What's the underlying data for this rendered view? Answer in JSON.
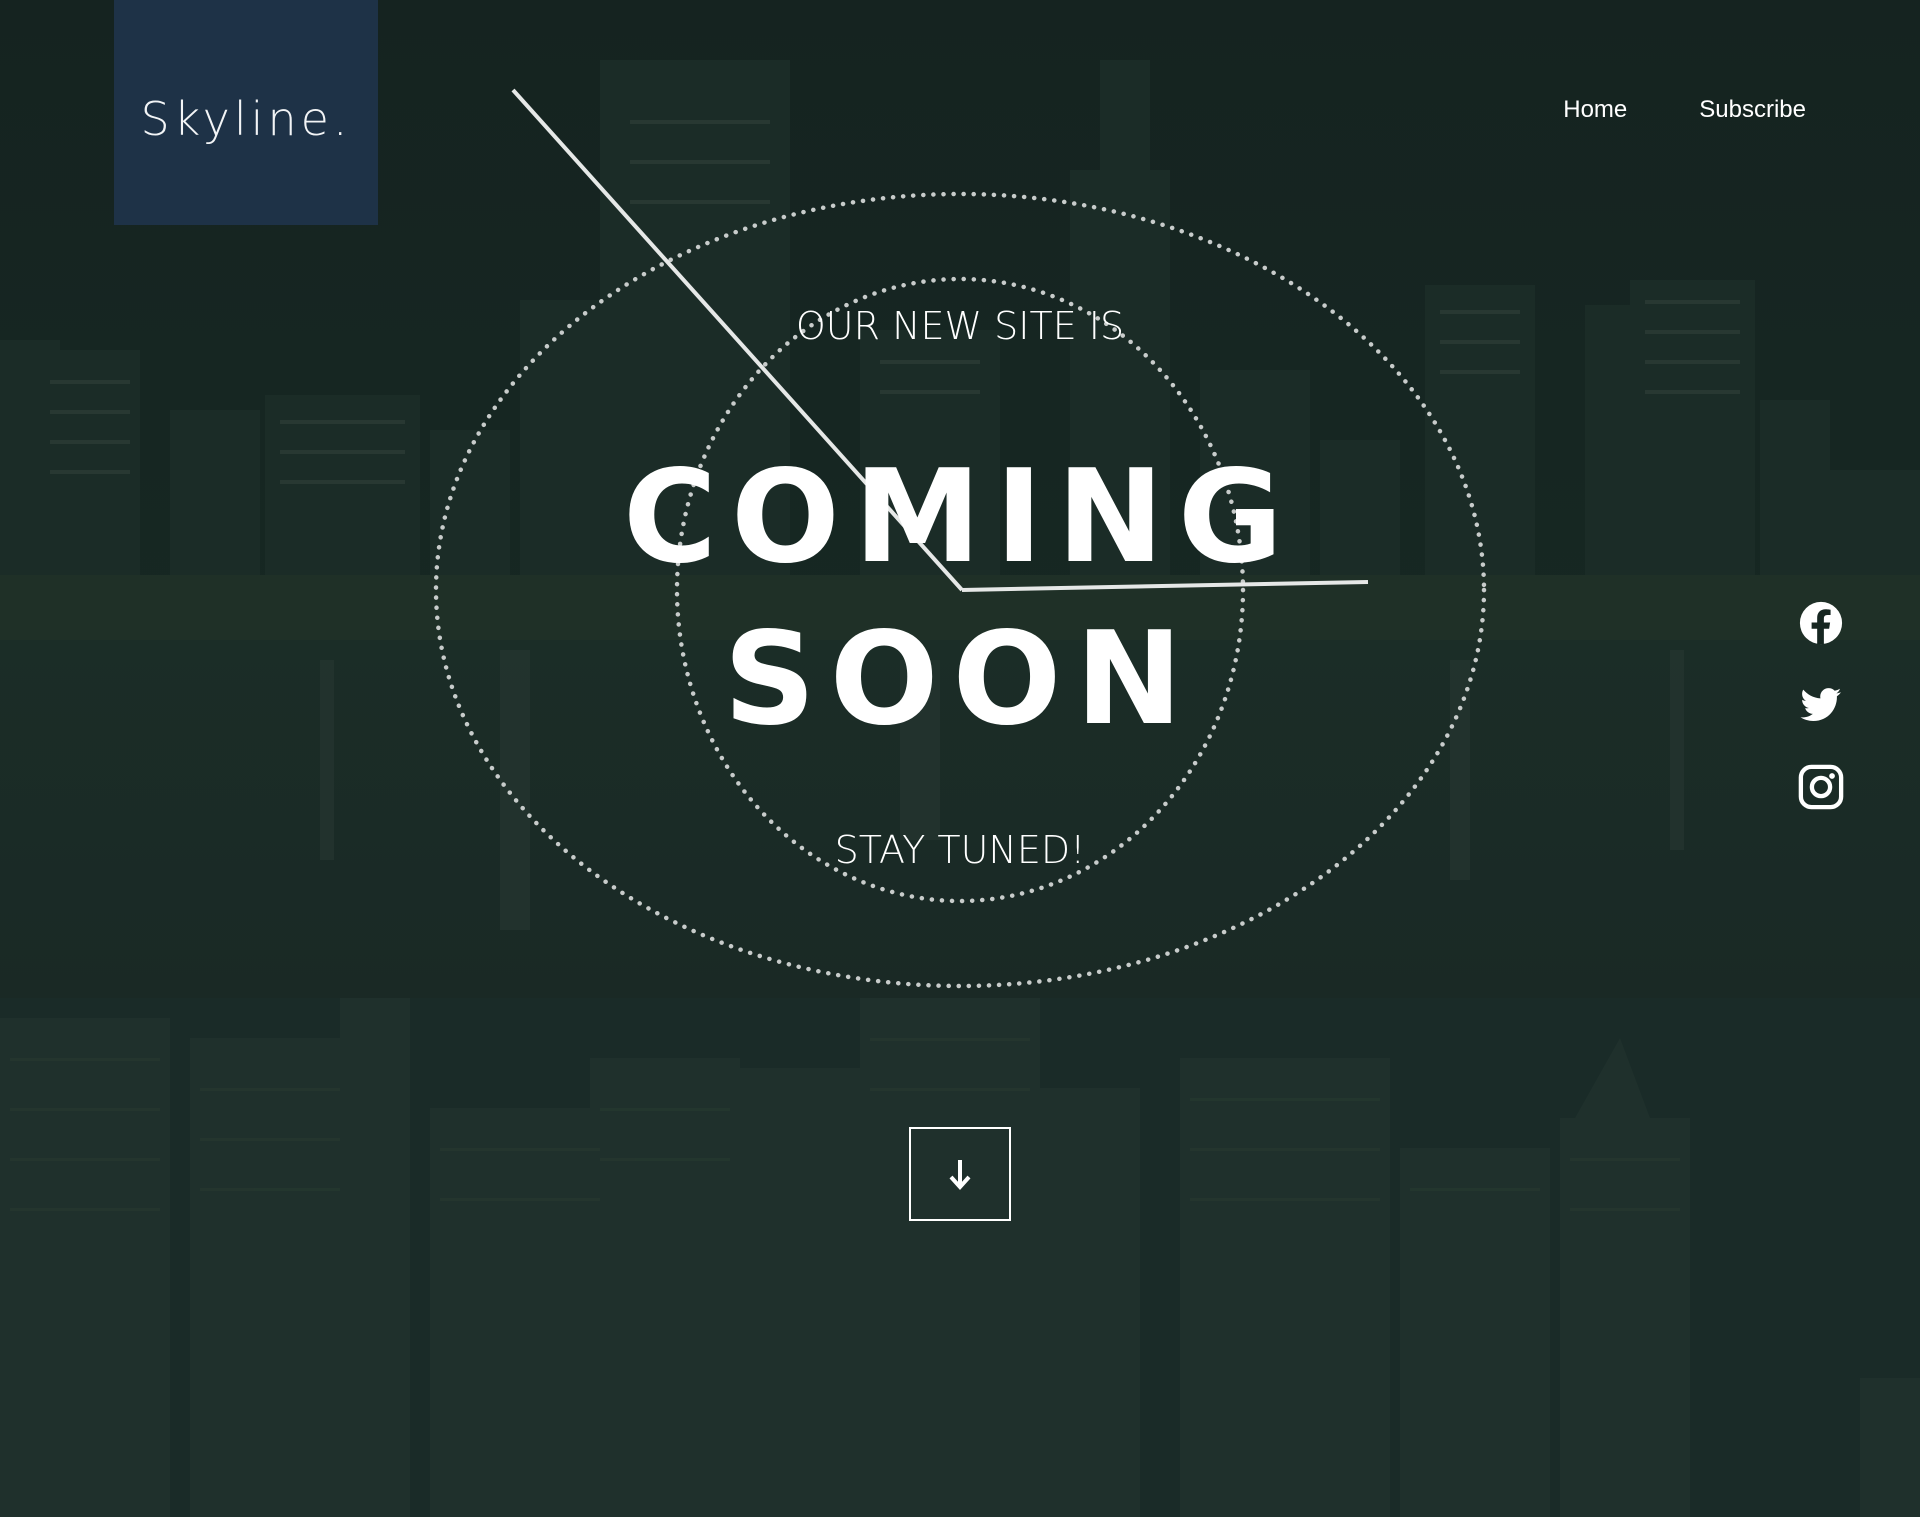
{
  "brand": {
    "logo_text": "Skyline."
  },
  "nav": {
    "items": [
      {
        "label": "Home"
      },
      {
        "label": "Subscribe"
      }
    ]
  },
  "hero": {
    "tagline_top": "OUR NEW SITE IS",
    "headline_line1": "COMING",
    "headline_line2": "SOON",
    "tagline_bottom": "STAY TUNED!"
  },
  "social": {
    "icons": [
      "facebook-icon",
      "twitter-icon",
      "instagram-icon"
    ]
  },
  "scroll": {
    "icon": "arrow-down-icon"
  },
  "colors": {
    "background": "#162621",
    "logo_box": "#1e3247",
    "text": "#ffffff",
    "dotted_ring": "#c8cccb"
  }
}
